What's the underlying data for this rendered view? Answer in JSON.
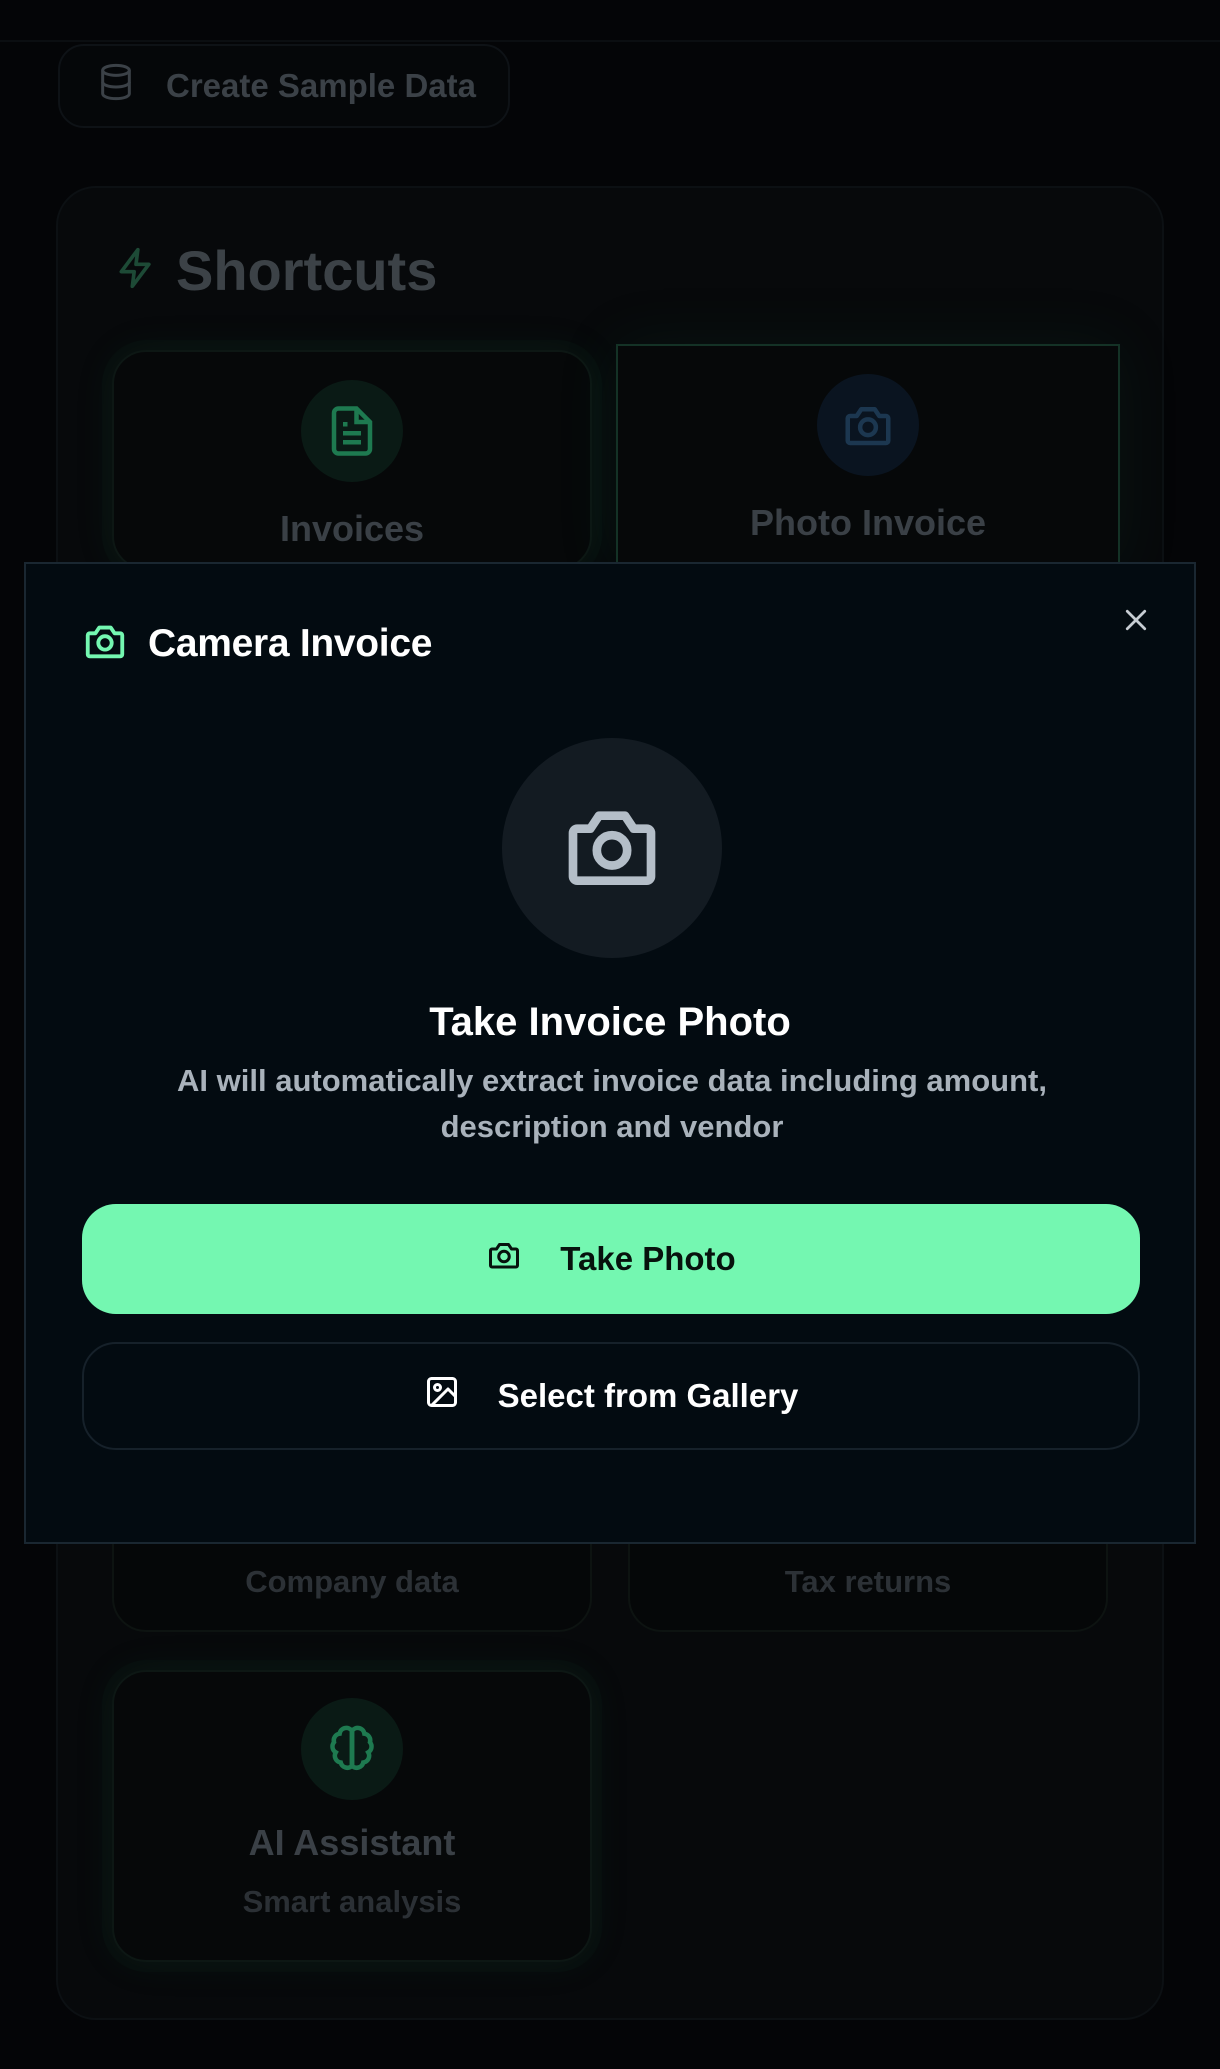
{
  "background": {
    "sample_button": {
      "label": "Create Sample Data",
      "icon": "database-icon"
    },
    "shortcuts": {
      "title": "Shortcuts",
      "icon": "lightning-icon",
      "cards": [
        {
          "title": "Invoices",
          "icon": "file-text-icon"
        },
        {
          "title": "Photo Invoice",
          "icon": "camera-icon"
        },
        {
          "subtitle": "Company data"
        },
        {
          "subtitle": "Tax returns"
        },
        {
          "title": "AI Assistant",
          "subtitle": "Smart analysis",
          "icon": "brain-icon"
        }
      ]
    }
  },
  "modal": {
    "title": "Camera Invoice",
    "title_icon": "camera-icon",
    "close_icon": "close-icon",
    "hero_icon": "camera-icon",
    "prompt_title": "Take Invoice Photo",
    "prompt_description": "AI will automatically extract invoice data including amount, description and vendor",
    "primary_button": {
      "label": "Take Photo",
      "icon": "camera-icon"
    },
    "secondary_button": {
      "label": "Select from Gallery",
      "icon": "image-icon"
    }
  },
  "colors": {
    "accent": "#74f7b1",
    "modal_bg": "#030b11",
    "page_bg": "#040507"
  }
}
